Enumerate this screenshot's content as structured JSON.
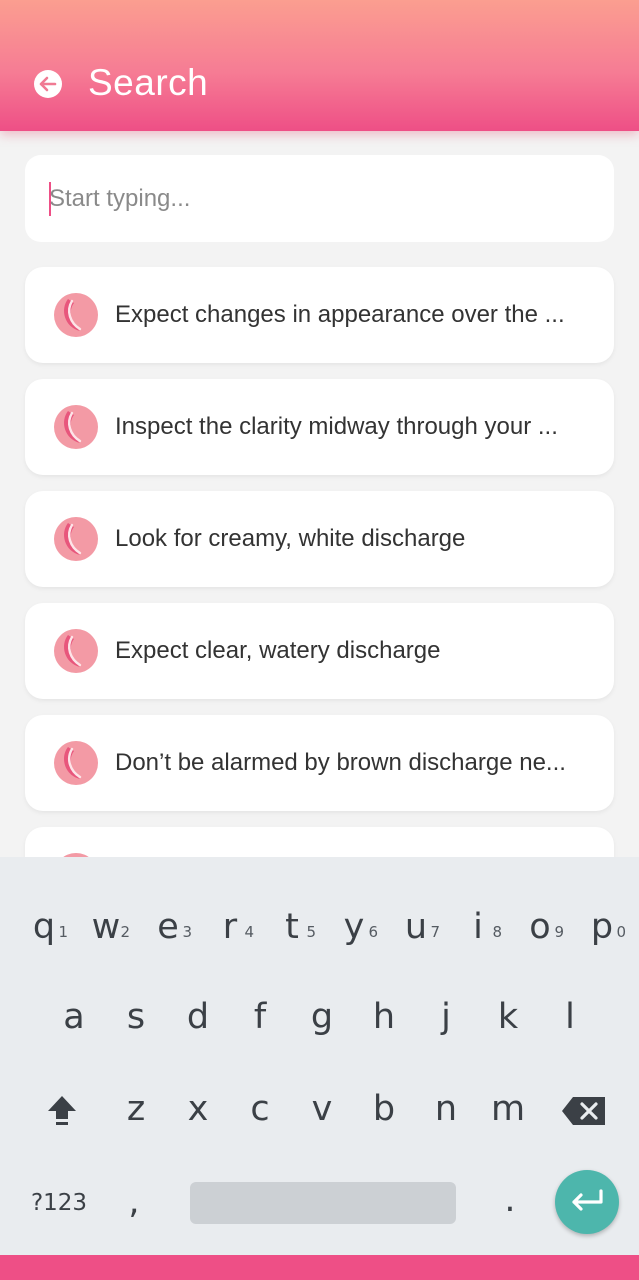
{
  "header": {
    "title": "Search",
    "back_icon": "arrow-back-circle-icon",
    "gradient_top": "#fb9e90",
    "gradient_bottom": "#ee4f86"
  },
  "search": {
    "placeholder": "Start typing...",
    "value": ""
  },
  "results": [
    {
      "label": "Expect changes in appearance over the ...",
      "icon": "brand-logo-icon"
    },
    {
      "label": "Inspect the clarity midway through your ...",
      "icon": "brand-logo-icon"
    },
    {
      "label": "Look for creamy, white discharge",
      "icon": "brand-logo-icon"
    },
    {
      "label": "Expect clear, watery discharge",
      "icon": "brand-logo-icon"
    },
    {
      "label": "Don’t be alarmed by brown discharge ne...",
      "icon": "brand-logo-icon"
    },
    {
      "label": "",
      "icon": "brand-logo-icon"
    }
  ],
  "keyboard": {
    "row1": [
      {
        "key": "q",
        "hint": "1"
      },
      {
        "key": "w",
        "hint": "2"
      },
      {
        "key": "e",
        "hint": "3"
      },
      {
        "key": "r",
        "hint": "4"
      },
      {
        "key": "t",
        "hint": "5"
      },
      {
        "key": "y",
        "hint": "6"
      },
      {
        "key": "u",
        "hint": "7"
      },
      {
        "key": "i",
        "hint": "8"
      },
      {
        "key": "o",
        "hint": "9"
      },
      {
        "key": "p",
        "hint": "0"
      }
    ],
    "row2": [
      "a",
      "s",
      "d",
      "f",
      "g",
      "h",
      "j",
      "k",
      "l"
    ],
    "row3": [
      "z",
      "x",
      "c",
      "v",
      "b",
      "n",
      "m"
    ],
    "symbols_key": "?123",
    "comma_key": ",",
    "period_key": ".",
    "shift_icon": "shift-arrow-icon",
    "backspace_icon": "backspace-icon",
    "enter_icon": "enter-return-icon",
    "enter_color": "#4db6ac"
  },
  "colors": {
    "accent": "#ee4f86",
    "background": "#f3f3f3",
    "card": "#ffffff"
  }
}
